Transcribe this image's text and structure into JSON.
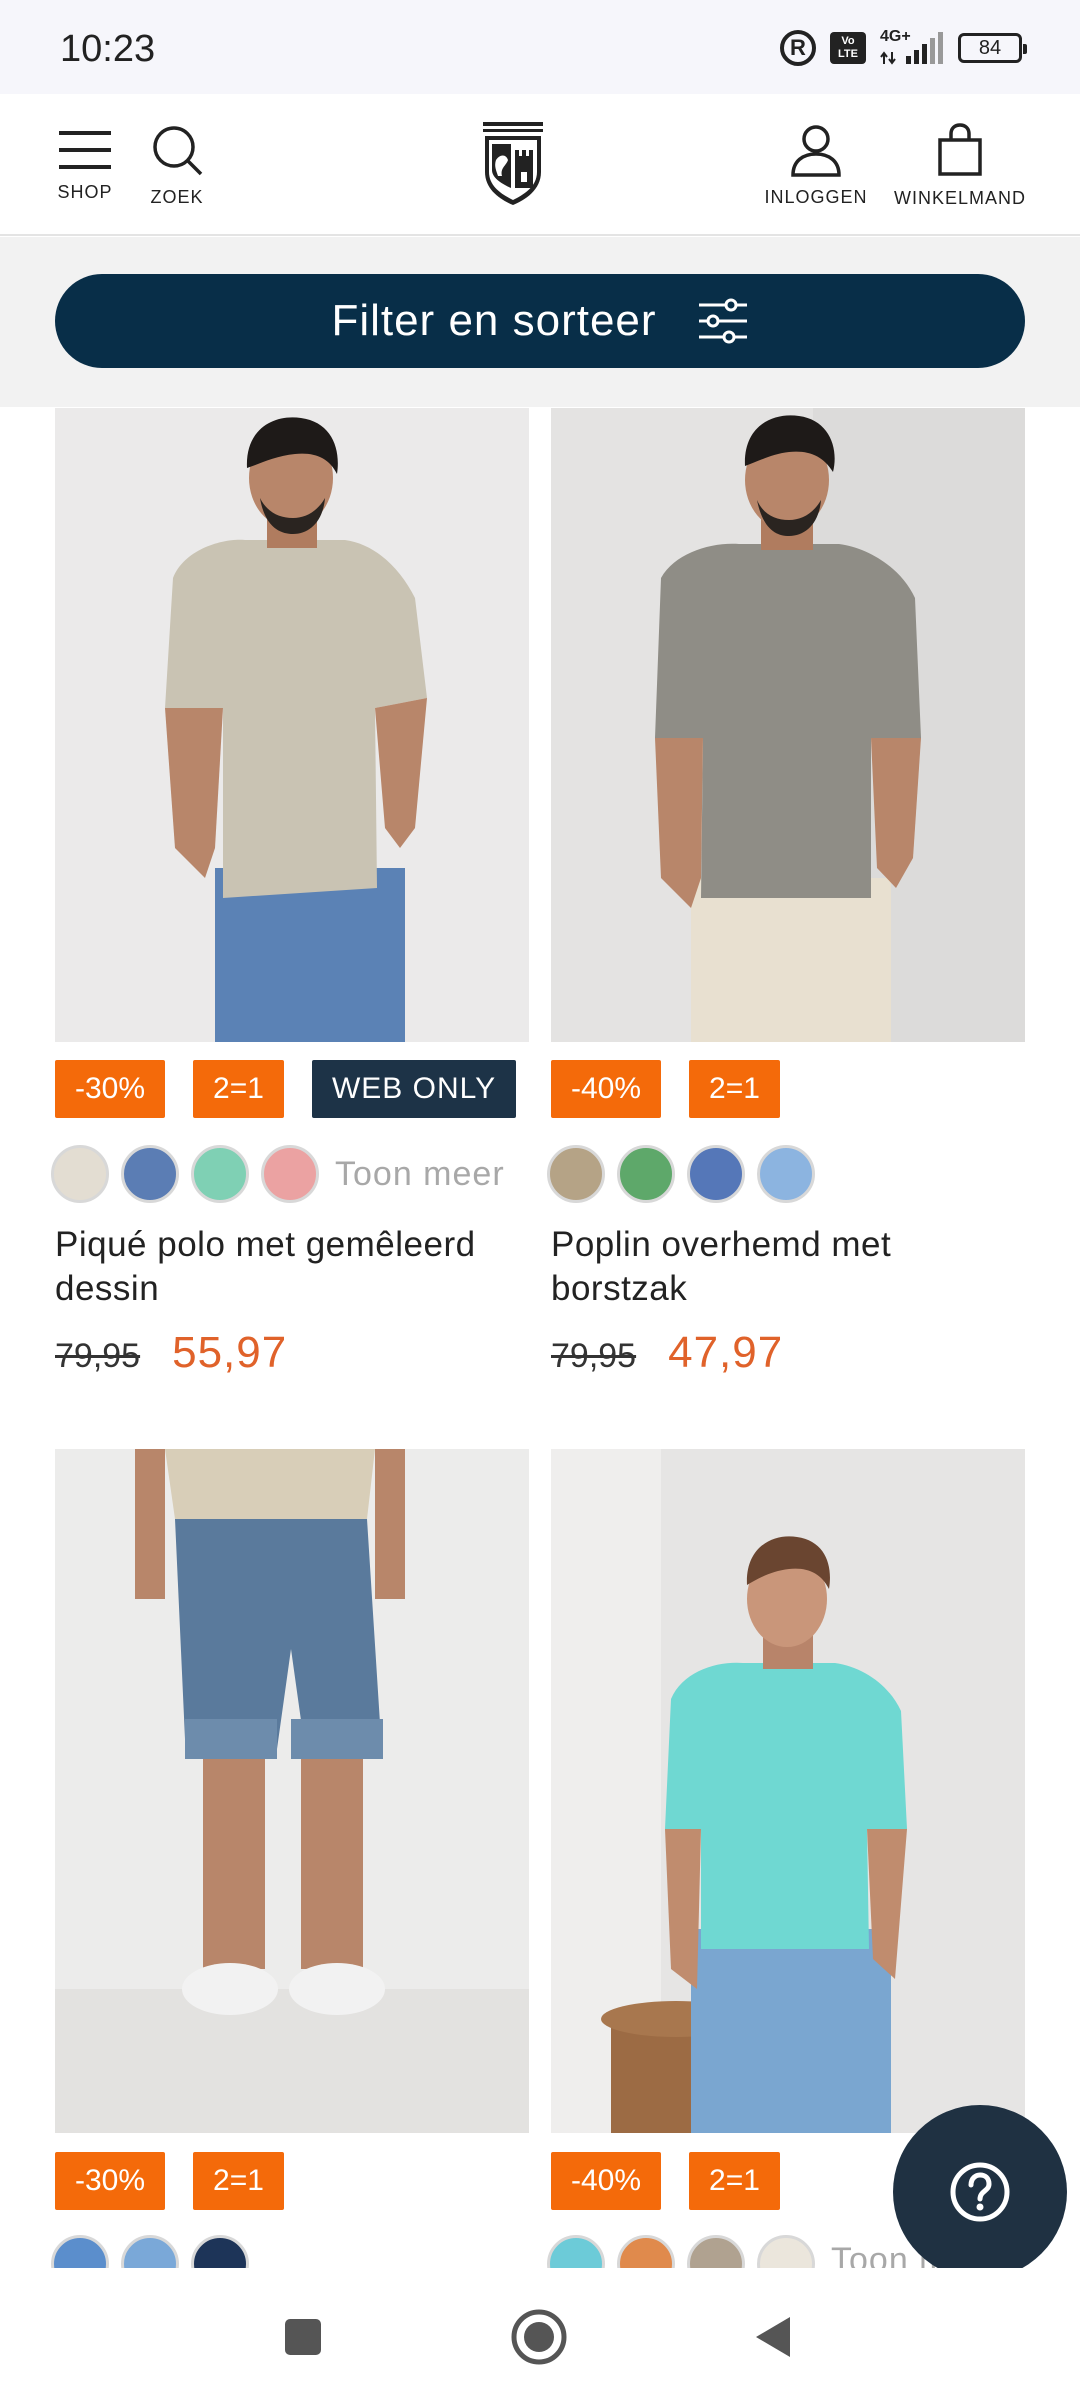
{
  "status_bar": {
    "time": "10:23",
    "network": "4G+",
    "volte": "Vo LTE",
    "battery": "84"
  },
  "header": {
    "shop_label": "SHOP",
    "search_label": "ZOEK",
    "login_label": "INLOGGEN",
    "cart_label": "WINKELMAND"
  },
  "filter": {
    "label": "Filter en sorteer"
  },
  "products": [
    {
      "badges": [
        "-30%",
        "2=1",
        "WEB ONLY"
      ],
      "swatch_colors": [
        "#e3ddd2",
        "#5b7db4",
        "#7fd0b4",
        "#eba2a2"
      ],
      "more_label": "Toon meer",
      "name": "Piqué polo met gemêleerd dessin",
      "old_price": "79,95",
      "new_price": "55,97"
    },
    {
      "badges": [
        "-40%",
        "2=1"
      ],
      "swatch_colors": [
        "#b5a386",
        "#5ea86a",
        "#5577b8",
        "#8cb4e0"
      ],
      "name": "Poplin overhemd met borstzak",
      "old_price": "79,95",
      "new_price": "47,97"
    },
    {
      "badges": [
        "-30%",
        "2=1"
      ],
      "swatch_colors": [
        "#5b8ecc",
        "#7aa8d8",
        "#1d3458"
      ]
    },
    {
      "badges": [
        "-40%",
        "2=1"
      ],
      "swatch_colors": [
        "#6ccbd8",
        "#e08a4c",
        "#b0a290",
        "#ebe6dc"
      ],
      "more_label": "Toon meer"
    }
  ]
}
